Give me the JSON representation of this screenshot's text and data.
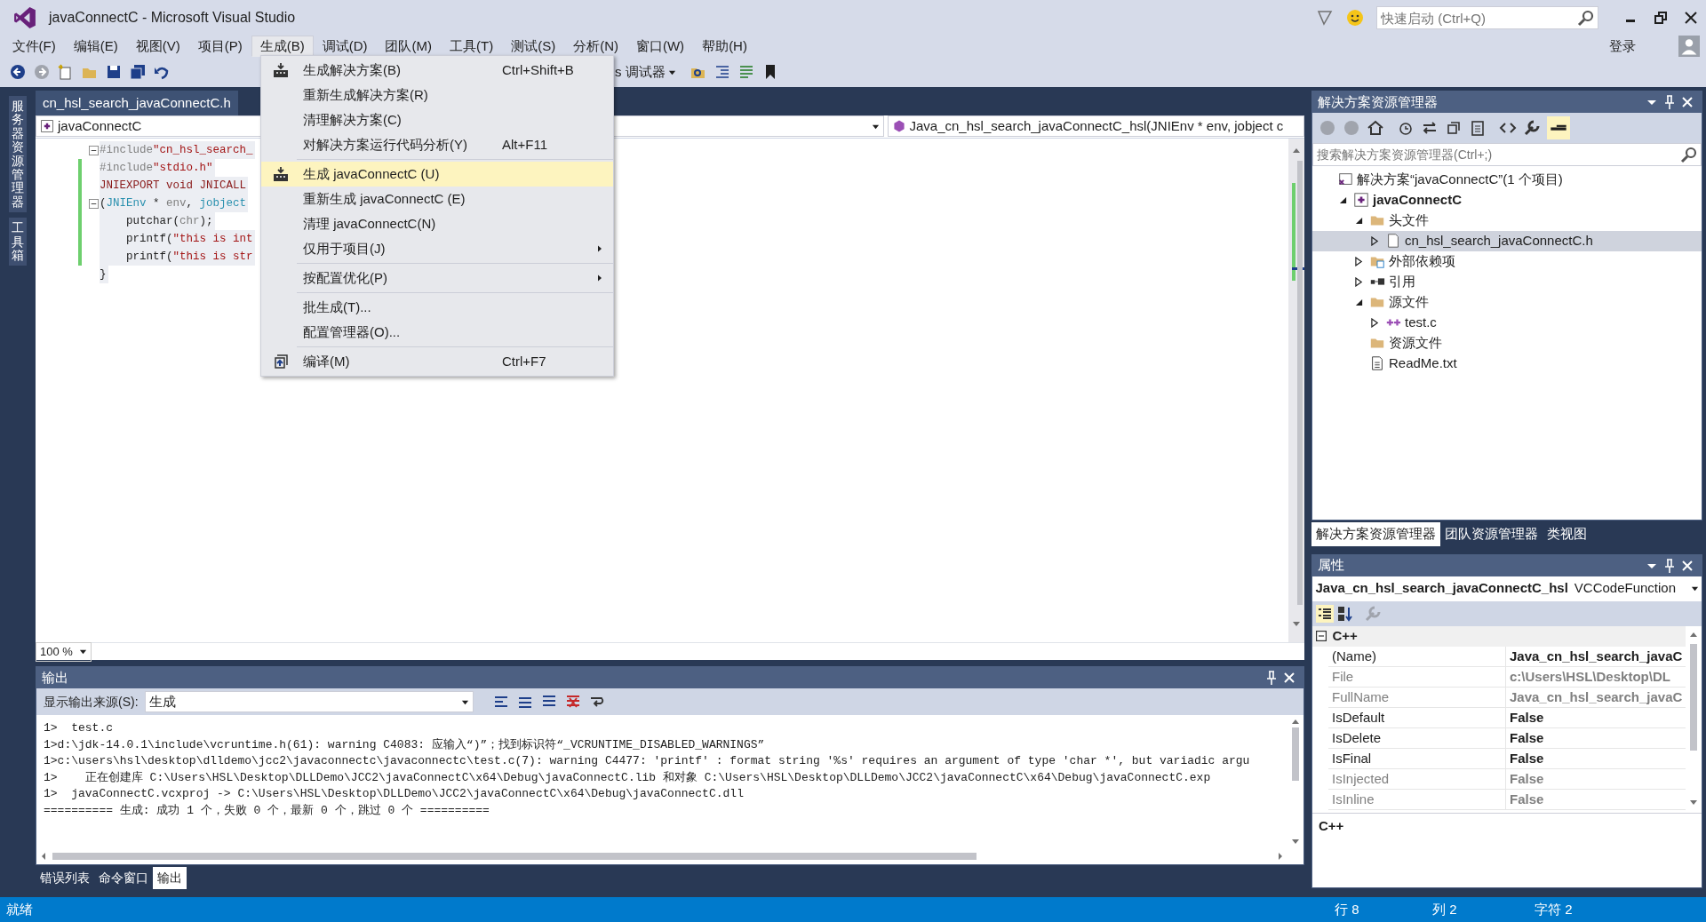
{
  "window": {
    "title": "javaConnectC - Microsoft Visual Studio",
    "quick_launch": {
      "placeholder": "快速启动 (Ctrl+Q)"
    },
    "sign_in": "登录"
  },
  "menu_bar": [
    {
      "label": "文件(F)",
      "selected": false
    },
    {
      "label": "编辑(E)",
      "selected": false
    },
    {
      "label": "视图(V)",
      "selected": false
    },
    {
      "label": "项目(P)",
      "selected": false
    },
    {
      "label": "生成(B)",
      "selected": true
    },
    {
      "label": "调试(D)",
      "selected": false
    },
    {
      "label": "团队(M)",
      "selected": false
    },
    {
      "label": "工具(T)",
      "selected": false
    },
    {
      "label": "测试(S)",
      "selected": false
    },
    {
      "label": "分析(N)",
      "selected": false
    },
    {
      "label": "窗口(W)",
      "selected": false
    },
    {
      "label": "帮助(H)",
      "selected": false
    }
  ],
  "toolbar": {
    "debugger_combo": "s 调试器"
  },
  "build_menu": {
    "groups": [
      [
        {
          "label": "生成解决方案(B)",
          "shortcut": "Ctrl+Shift+B",
          "kind": "build",
          "submenu": false,
          "selected": false
        },
        {
          "label": "重新生成解决方案(R)",
          "submenu": false,
          "selected": false
        },
        {
          "label": "清理解决方案(C)",
          "submenu": false,
          "selected": false
        },
        {
          "label": "对解决方案运行代码分析(Y)",
          "shortcut": "Alt+F11",
          "submenu": false,
          "selected": false
        }
      ],
      [
        {
          "label": "生成 javaConnectC (U)",
          "kind": "build",
          "submenu": false,
          "selected": true
        },
        {
          "label": "重新生成 javaConnectC (E)",
          "submenu": false,
          "selected": false
        },
        {
          "label": "清理 javaConnectC(N)",
          "submenu": false,
          "selected": false
        },
        {
          "label": "仅用于项目(J)",
          "submenu": true,
          "selected": false
        }
      ],
      [
        {
          "label": "按配置优化(P)",
          "submenu": true,
          "selected": false
        }
      ],
      [
        {
          "label": "批生成(T)...",
          "submenu": false,
          "selected": false
        },
        {
          "label": "配置管理器(O)...",
          "submenu": false,
          "selected": false
        }
      ],
      [
        {
          "label": "编译(M)",
          "shortcut": "Ctrl+F7",
          "kind": "compile",
          "submenu": false,
          "selected": false
        }
      ]
    ]
  },
  "side_strip": [
    "服务器资源管理器",
    "工具箱"
  ],
  "editor": {
    "tab": "cn_hsl_search_javaConnectC.h",
    "project_combo": "javaConnectC",
    "member_combo": "Java_cn_hsl_search_javaConnectC_hsl(JNIEnv * env, jobject c",
    "zoom": "100 %",
    "lines": [
      {
        "fold": true,
        "changed": false,
        "tokens": [
          {
            "kind": "directive",
            "text": "#include"
          },
          {
            "kind": "string",
            "text": "\"cn_hsl_search_"
          }
        ]
      },
      {
        "fold": false,
        "changed": true,
        "tokens": [
          {
            "kind": "directive",
            "text": "#include"
          },
          {
            "kind": "string",
            "text": "\"stdio.h\""
          }
        ]
      },
      {
        "fold": false,
        "changed": true,
        "tokens": [
          {
            "kind": "macro",
            "text": "JNIEXPORT void JNICALL"
          }
        ]
      },
      {
        "fold": true,
        "changed": true,
        "tokens": [
          {
            "kind": "plain",
            "text": "("
          },
          {
            "kind": "type",
            "text": "JNIEnv"
          },
          {
            "kind": "plain",
            "text": " * "
          },
          {
            "kind": "param",
            "text": "env"
          },
          {
            "kind": "plain",
            "text": ", "
          },
          {
            "kind": "type",
            "text": "jobject"
          }
        ]
      },
      {
        "fold": false,
        "changed": true,
        "tokens": [
          {
            "kind": "plain",
            "text": "    putchar("
          },
          {
            "kind": "param",
            "text": "chr"
          },
          {
            "kind": "plain",
            "text": ");"
          }
        ]
      },
      {
        "fold": false,
        "changed": true,
        "tokens": [
          {
            "kind": "plain",
            "text": "    printf("
          },
          {
            "kind": "string",
            "text": "\"this is int"
          }
        ]
      },
      {
        "fold": false,
        "changed": true,
        "tokens": [
          {
            "kind": "plain",
            "text": "    printf("
          },
          {
            "kind": "string",
            "text": "\"this is str"
          }
        ]
      },
      {
        "fold": false,
        "changed": false,
        "tokens": [
          {
            "kind": "plain",
            "text": "}"
          }
        ]
      }
    ]
  },
  "output": {
    "title": "输出",
    "source_label": "显示输出来源(S):",
    "source": "生成",
    "lines": [
      "1>  test.c",
      "1>d:\\jdk-14.0.1\\include\\vcruntime.h(61): warning C4083: 应输入“)”；找到标识符“_VCRUNTIME_DISABLED_WARNINGS”",
      "1>c:\\users\\hsl\\desktop\\dlldemo\\jcc2\\javaconnectc\\javaconnectc\\test.c(7): warning C4477: 'printf' : format string '%s' requires an argument of type 'char *', but variadic argu",
      "1>    正在创建库 C:\\Users\\HSL\\Desktop\\DLLDemo\\JCC2\\javaConnectC\\x64\\Debug\\javaConnectC.lib 和对象 C:\\Users\\HSL\\Desktop\\DLLDemo\\JCC2\\javaConnectC\\x64\\Debug\\javaConnectC.exp",
      "1>  javaConnectC.vcxproj -> C:\\Users\\HSL\\Desktop\\DLLDemo\\JCC2\\javaConnectC\\x64\\Debug\\javaConnectC.dll",
      "========== 生成: 成功 1 个，失败 0 个，最新 0 个，跳过 0 个 =========="
    ],
    "tabs": [
      {
        "label": "错误列表",
        "selected": false
      },
      {
        "label": "命令窗口",
        "selected": false
      },
      {
        "label": "输出",
        "selected": true
      }
    ]
  },
  "solution_explorer": {
    "title": "解决方案资源管理器",
    "search": {
      "placeholder": "搜索解决方案资源管理器(Ctrl+;)"
    },
    "tree": [
      {
        "label": "解决方案“javaConnectC”(1 个项目)",
        "kind": "solution",
        "selected": false,
        "children": [
          {
            "label": "javaConnectC",
            "kind": "project",
            "expanded": true,
            "selected": false,
            "children": [
              {
                "label": "头文件",
                "kind": "folder",
                "expanded": true,
                "selected": false,
                "children": [
                  {
                    "label": "cn_hsl_search_javaConnectC.h",
                    "kind": "header",
                    "expanded": false,
                    "selected": true
                  }
                ]
              },
              {
                "label": "外部依赖项",
                "kind": "deps",
                "expanded": false,
                "selected": false
              },
              {
                "label": "引用",
                "kind": "refs",
                "expanded": false,
                "selected": false
              },
              {
                "label": "源文件",
                "kind": "folder",
                "expanded": true,
                "selected": false,
                "children": [
                  {
                    "label": "test.c",
                    "kind": "source",
                    "expanded": false,
                    "selected": false
                  }
                ]
              },
              {
                "label": "资源文件",
                "kind": "folder",
                "selected": false
              },
              {
                "label": "ReadMe.txt",
                "kind": "text",
                "selected": false
              }
            ]
          }
        ]
      }
    ],
    "tabs": [
      {
        "label": "解决方案资源管理器",
        "selected": true
      },
      {
        "label": "团队资源管理器",
        "selected": false
      },
      {
        "label": "类视图",
        "selected": false
      }
    ]
  },
  "properties": {
    "title": "属性",
    "object_name": "Java_cn_hsl_search_javaConnectC_hsl",
    "object_type": "VCCodeFunction",
    "category": "C++",
    "rows": [
      {
        "name": "(Name)",
        "value": "Java_cn_hsl_search_javaC",
        "readonly": false,
        "bold": true
      },
      {
        "name": "File",
        "value": "c:\\Users\\HSL\\Desktop\\DL",
        "readonly": true,
        "bold": true
      },
      {
        "name": "FullName",
        "value": "Java_cn_hsl_search_javaC",
        "readonly": true,
        "bold": true
      },
      {
        "name": "IsDefault",
        "value": "False",
        "readonly": false,
        "bold": true
      },
      {
        "name": "IsDelete",
        "value": "False",
        "readonly": false,
        "bold": true
      },
      {
        "name": "IsFinal",
        "value": "False",
        "readonly": false,
        "bold": true
      },
      {
        "name": "IsInjected",
        "value": "False",
        "readonly": true,
        "bold": true
      },
      {
        "name": "IsInline",
        "value": "False",
        "readonly": true,
        "bold": true
      }
    ],
    "description": "C++"
  },
  "status_bar": {
    "message": "就绪",
    "line": "行 8",
    "column": "列 2",
    "char": "字符 2"
  }
}
